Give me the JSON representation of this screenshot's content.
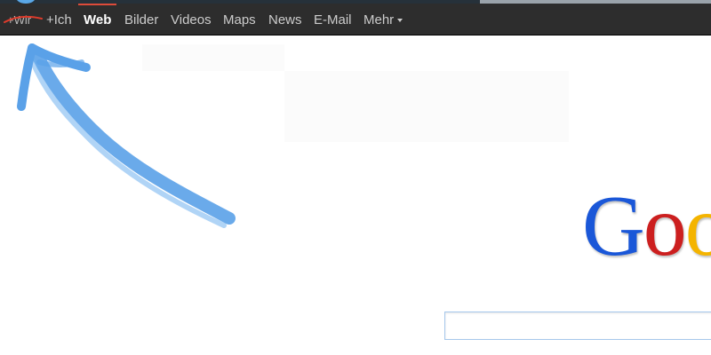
{
  "navbar": {
    "items": [
      {
        "label": "+Wir",
        "state": "struck-through"
      },
      {
        "label": "+Ich"
      },
      {
        "label": "Web",
        "state": "active"
      },
      {
        "label": "Bilder"
      },
      {
        "label": "Videos"
      },
      {
        "label": "Maps"
      },
      {
        "label": "News"
      },
      {
        "label": "E-Mail"
      },
      {
        "label": "Mehr",
        "has_dropdown": true
      }
    ]
  },
  "annotation": {
    "arrow_color": "#5aa1e8",
    "arrow_icon": "hand-drawn-arrow-icon"
  },
  "logo": {
    "letters": [
      {
        "char": "G",
        "color": "#1a57d8"
      },
      {
        "char": "o",
        "color": "#cc1f1f"
      },
      {
        "char": "o",
        "color": "#f4b400"
      }
    ]
  },
  "search": {
    "value": "",
    "placeholder": ""
  },
  "colors": {
    "navbar_bg": "#2d2d2d",
    "active_accent": "#dd4b39",
    "strike_color": "#dd3b2b",
    "search_border": "#a6c8ec"
  }
}
